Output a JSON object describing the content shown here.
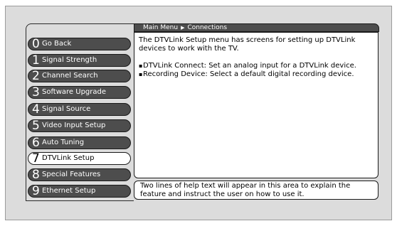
{
  "breadcrumb": {
    "root": "Main Menu",
    "separator": "▶",
    "current": "Connections"
  },
  "menu": {
    "items": [
      {
        "number": "0",
        "label": "Go Back",
        "selected": false
      },
      {
        "number": "1",
        "label": "Signal Strength",
        "selected": false
      },
      {
        "number": "2",
        "label": "Channel Search",
        "selected": false
      },
      {
        "number": "3",
        "label": "Software Upgrade",
        "selected": false
      },
      {
        "number": "4",
        "label": "Signal Source",
        "selected": false
      },
      {
        "number": "5",
        "label": "Video Input Setup",
        "selected": false
      },
      {
        "number": "6",
        "label": "Auto Tuning",
        "selected": false
      },
      {
        "number": "7",
        "label": "DTVLink Setup",
        "selected": true
      },
      {
        "number": "8",
        "label": "Special Features",
        "selected": false
      },
      {
        "number": "9",
        "label": "Ethernet Setup",
        "selected": false
      }
    ]
  },
  "content": {
    "intro": "The DTVLink Setup menu has screens for setting up DTVLink devices to work with the TV.",
    "bullet_char": "▪",
    "bullets": [
      "DTVLink Connect: Set an analog input for a DTVLink device.",
      "Recording Device: Select a default digital recording device."
    ]
  },
  "help": {
    "text": "Two lines of help text will appear in this area to explain the feature and instruct the user on how to use it."
  },
  "colors": {
    "background": "#dcdcdc",
    "button": "#4d4d4d",
    "button_selected": "#ffffff",
    "panel": "#ffffff",
    "outline": "#1a1a1a"
  }
}
